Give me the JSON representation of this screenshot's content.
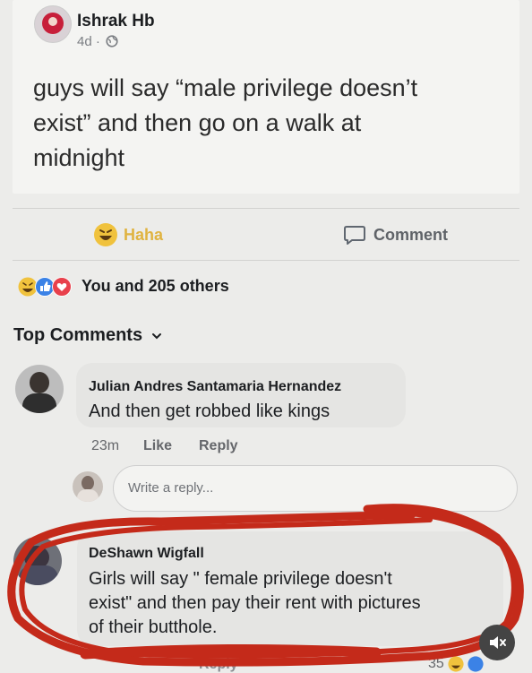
{
  "post": {
    "author": "Ishrak Hb",
    "time": "4d ·",
    "text_line1": "guys will say “male privilege doesn’t",
    "text_line2": "exist” and then go on a walk at",
    "text_line3": "midnight"
  },
  "actions": {
    "haha_label": "Haha",
    "comment_label": "Comment"
  },
  "reactions": {
    "summary": "You and 205 others"
  },
  "comments_header": {
    "title": "Top Comments"
  },
  "comment1": {
    "author": "Julian Andres Santamaria Hernandez",
    "text": "And then get robbed like kings",
    "time": "23m",
    "like_label": "Like",
    "reply_label": "Reply"
  },
  "reply_box": {
    "placeholder": "Write a reply..."
  },
  "comment2": {
    "author": "DeShawn Wigfall",
    "text_line1": "Girls will say \" female privilege doesn't",
    "text_line2": "exist\" and then pay their rent with pictures",
    "text_line3": "of their butthole.",
    "reply_label": "Reply",
    "reaction_count": "35"
  },
  "colors": {
    "scribble": "#c42a1a",
    "haha": "#f0c23d",
    "like_blue": "#3b82e6",
    "love_red": "#e8414c"
  }
}
